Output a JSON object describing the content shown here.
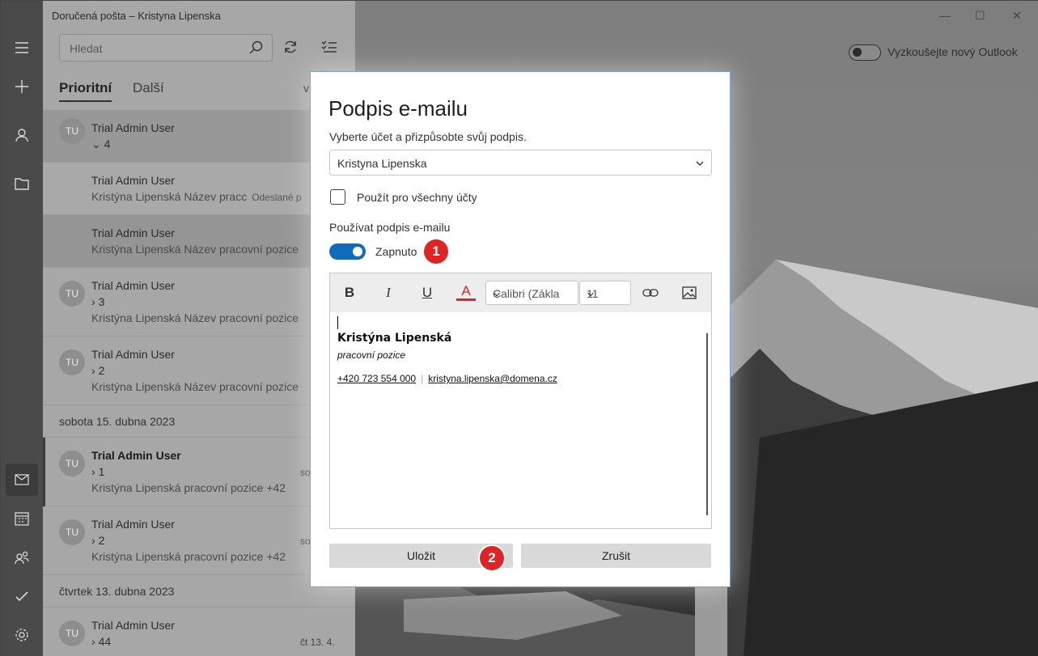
{
  "window": {
    "title": "Doručená pošta – Kristyna Lipenska",
    "try_new_outlook": "Vyzkoušejte nový Outlook"
  },
  "search": {
    "placeholder": "Hledat"
  },
  "tabs": {
    "focused": "Prioritní",
    "other": "Další",
    "filter": "v"
  },
  "messages": [
    {
      "sender": "Trial Admin User",
      "count": "4",
      "initials": "TU"
    },
    {
      "sender": "Trial Admin User",
      "preview": "Kristýna Lipenská Název pracc",
      "folder": "Odeslané p"
    },
    {
      "sender": "Trial Admin User",
      "preview": "Kristýna Lipenská Název pracovní pozice"
    },
    {
      "sender": "Trial Admin User",
      "count": "3",
      "preview": "Kristýna Lipenská Název pracovní pozice",
      "initials": "TU"
    },
    {
      "sender": "Trial Admin User",
      "count": "2",
      "preview": "Kristýna Lipenská Název pracovní pozice",
      "initials": "TU"
    },
    {
      "sender": "Trial Admin User",
      "count": "1",
      "preview": "Kristýna Lipenská pracovní pozice +42",
      "date": "so",
      "initials": "TU"
    },
    {
      "sender": "Trial Admin User",
      "count": "2",
      "preview": "Kristýna Lipenská pracovní pozice +42",
      "date": "so",
      "initials": "TU"
    },
    {
      "sender": "Trial Admin User",
      "count": "44",
      "date": "čt 13. 4.",
      "initials": "TU"
    }
  ],
  "sections": {
    "saturday": "sobota 15. dubna 2023",
    "thursday": "čtvrtek 13. dubna 2023"
  },
  "dialog": {
    "title": "Podpis e-mailu",
    "subtitle": "Vyberte účet a přizpůsobte svůj podpis.",
    "account": "Kristyna Lipenska",
    "apply_all": "Použít pro všechny účty",
    "use_signature": "Používat podpis e-mailu",
    "toggle_state": "Zapnuto",
    "toggle_on": true,
    "font": "Calibri (Zákla",
    "font_size": "11",
    "toolbar": {
      "bold": "B",
      "italic": "I",
      "underline": "U",
      "color": "A"
    },
    "signature": {
      "name": "Kristýna Lipenská",
      "role": "pracovní pozice",
      "phone": "+420 723 554 000",
      "separator": "|",
      "email": "kristyna.lipenska@domena.cz"
    },
    "save": "Uložit",
    "cancel": "Zrušit"
  },
  "badges": {
    "one": "1",
    "two": "2"
  },
  "colors": {
    "accent": "#0f6cbd",
    "badge": "#e02424",
    "font_color_bar": "#e02424"
  }
}
